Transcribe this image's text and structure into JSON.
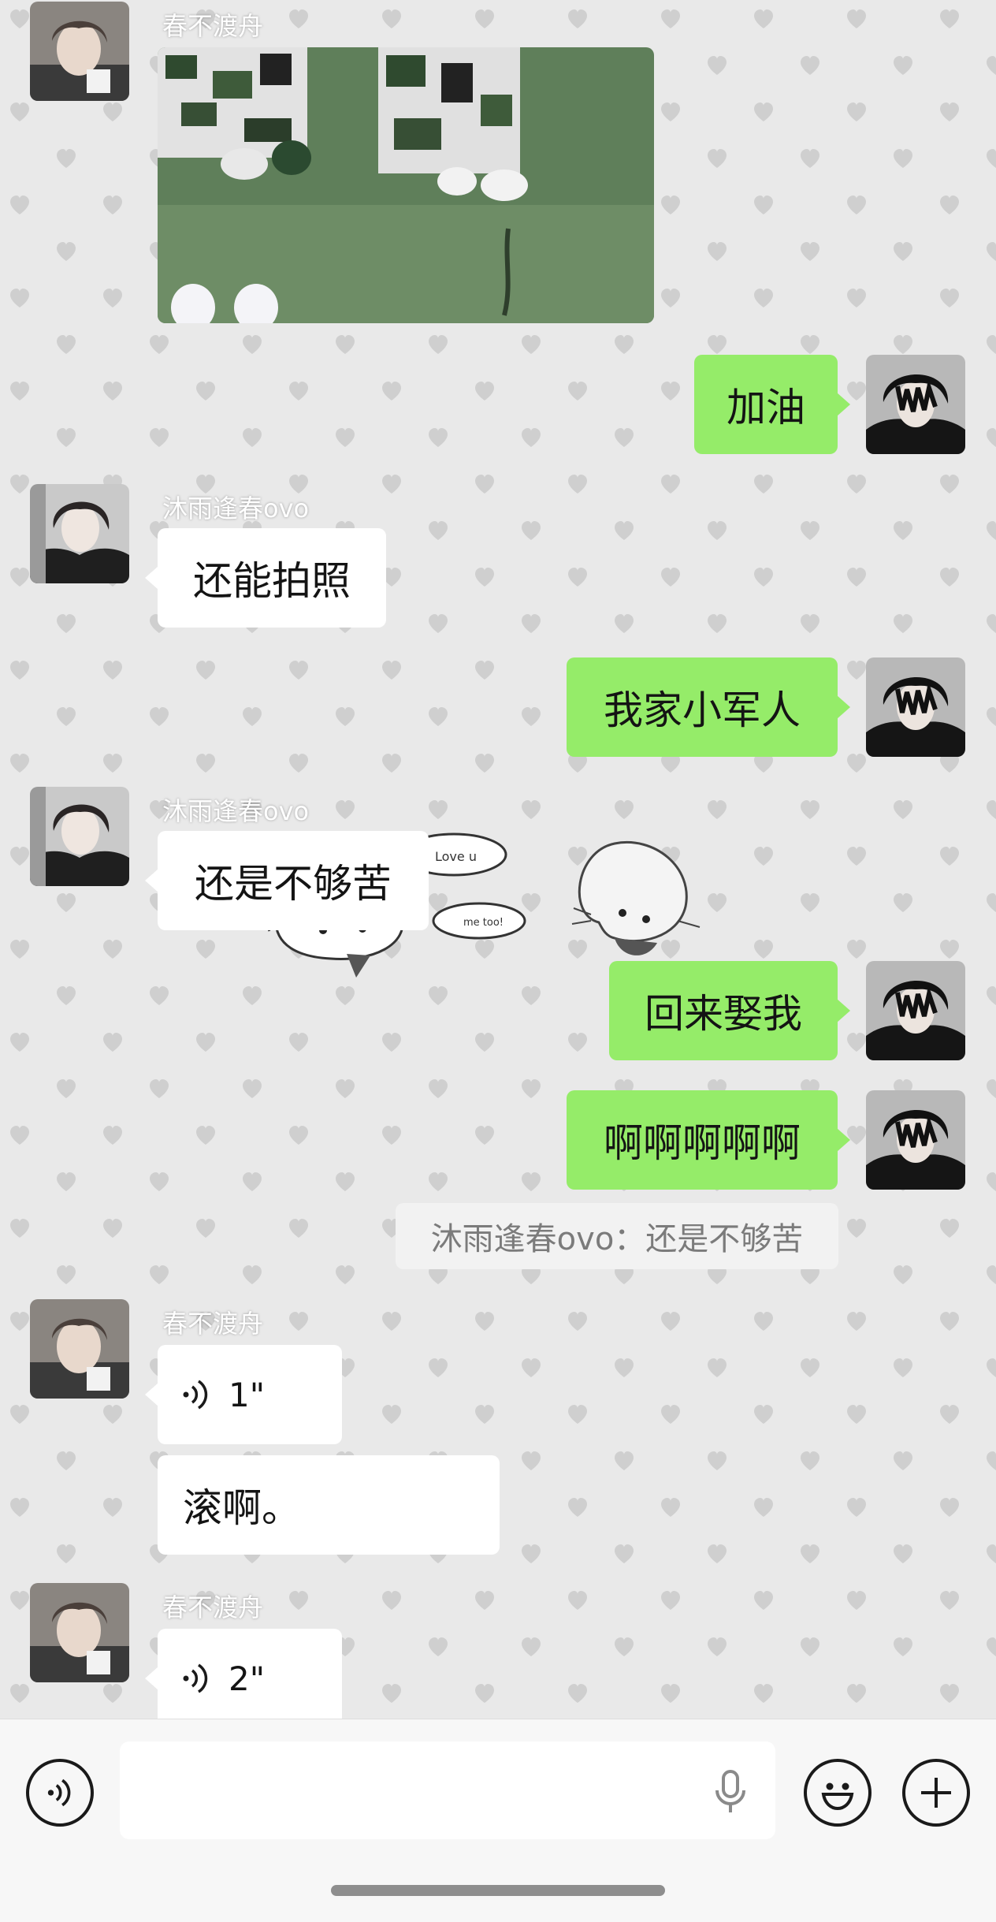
{
  "messages": {
    "m1": {
      "sender": "春不渡舟",
      "type": "image"
    },
    "m2": {
      "text": "加油"
    },
    "m3": {
      "sender": "沐雨逢春ovo",
      "text": "还能拍照"
    },
    "m4": {
      "text": "我家小军人"
    },
    "m5": {
      "sender": "沐雨逢春ovo",
      "text": "还是不够苦"
    },
    "m6": {
      "text": "回来娶我"
    },
    "m7": {
      "text": "啊啊啊啊啊"
    },
    "system": {
      "text": "沐雨逢春ovo：还是不够苦"
    },
    "m8": {
      "sender": "春不渡舟",
      "voice_duration": "1\"",
      "text": "滚啊。"
    },
    "m9": {
      "sender": "春不渡舟",
      "voice_duration": "2\""
    }
  },
  "sticker": {
    "text_love": "Love u",
    "text_metoo": "me too!"
  },
  "icons": {
    "voice": "voice-mode-icon",
    "mic": "microphone-icon",
    "emoji": "emoji-icon",
    "plus": "plus-icon"
  },
  "colors": {
    "self_bubble": "#95ec69",
    "other_bubble": "#ffffff",
    "background": "#e9e9e9"
  }
}
